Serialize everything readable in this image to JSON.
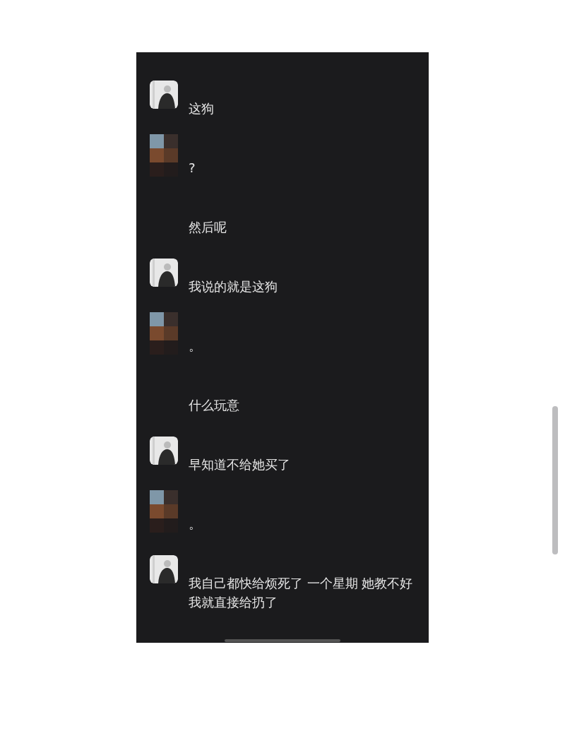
{
  "messages": [
    {
      "avatar": {
        "kind": "photo"
      },
      "text": "这狗"
    },
    {
      "avatar": {
        "kind": "mosaic"
      },
      "text": "?"
    },
    {
      "avatar": {
        "kind": "blank"
      },
      "text": "然后呢"
    },
    {
      "avatar": {
        "kind": "photo"
      },
      "text": "我说的就是这狗"
    },
    {
      "avatar": {
        "kind": "mosaic"
      },
      "text": "。"
    },
    {
      "avatar": {
        "kind": "blank"
      },
      "text": "什么玩意"
    },
    {
      "avatar": {
        "kind": "photo"
      },
      "text": "早知道不给她买了"
    },
    {
      "avatar": {
        "kind": "mosaic"
      },
      "text": "。"
    },
    {
      "avatar": {
        "kind": "photo"
      },
      "text": "我自己都快给烦死了 一个星期 她教不好我就直接给扔了"
    }
  ]
}
